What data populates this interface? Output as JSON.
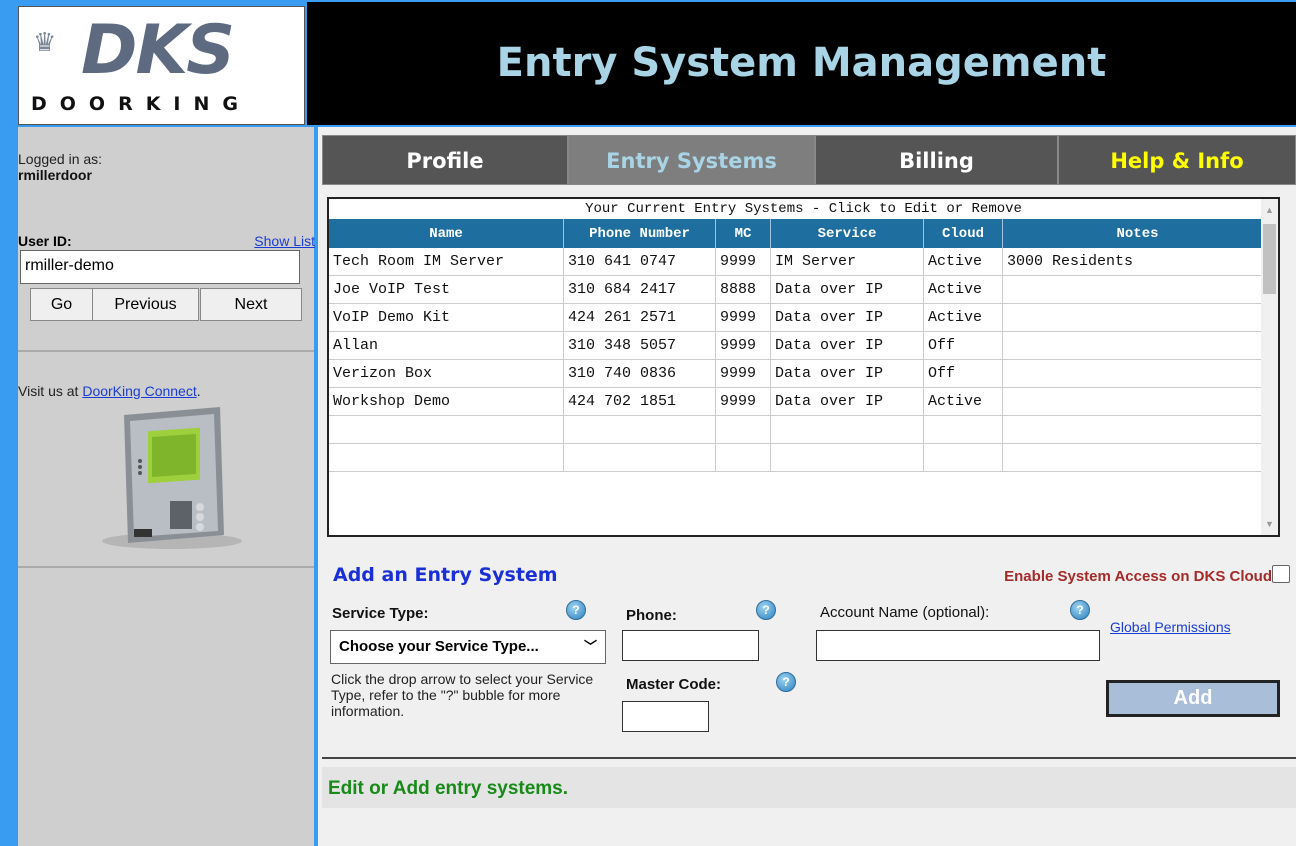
{
  "logo": {
    "brand": "DKS",
    "sub": "DOORKING"
  },
  "header": {
    "title": "Entry System Management"
  },
  "sidebar": {
    "logged_in_label": "Logged in as:",
    "username": "rmillerdoor",
    "user_id_label": "User ID:",
    "show_list": "Show List",
    "user_id_value": "rmiller-demo",
    "go": "Go",
    "previous": "Previous",
    "next": "Next",
    "visit_prefix": "Visit us at ",
    "visit_link": "DoorKing Connect",
    "visit_suffix": "."
  },
  "tabs": [
    {
      "label": "Profile",
      "bg": "#555555",
      "color": "#ffffff"
    },
    {
      "label": "Entry Systems",
      "bg": "#7e7e7e",
      "color": "#a8d4e6"
    },
    {
      "label": "Billing",
      "bg": "#555555",
      "color": "#ffffff"
    },
    {
      "label": "Help & Info",
      "bg": "#555555",
      "color": "#ffff00"
    }
  ],
  "table": {
    "caption": "Your Current Entry Systems - Click to Edit or Remove",
    "headers": [
      "Name",
      "Phone Number",
      "MC",
      "Service",
      "Cloud",
      "Notes"
    ],
    "rows": [
      [
        "Tech Room IM Server",
        "310 641 0747",
        "9999",
        "IM Server",
        "Active",
        "3000 Residents"
      ],
      [
        "Joe VoIP Test",
        "310 684 2417",
        "8888",
        "Data over IP",
        "Active",
        ""
      ],
      [
        "VoIP Demo Kit",
        "424 261 2571",
        "9999",
        "Data over IP",
        "Active",
        ""
      ],
      [
        "Allan",
        "310 348 5057",
        "9999",
        "Data over IP",
        "Off",
        ""
      ],
      [
        "Verizon Box",
        "310 740 0836",
        "9999",
        "Data over IP",
        "Off",
        ""
      ],
      [
        "Workshop Demo",
        "424 702 1851",
        "9999",
        "Data over IP",
        "Active",
        ""
      ],
      [
        "",
        "",
        "",
        "",
        "",
        ""
      ],
      [
        "",
        "",
        "",
        "",
        "",
        ""
      ]
    ]
  },
  "add": {
    "title": "Add an Entry System",
    "cloud_label": "Enable System Access on DKS Cloud",
    "service_type_label": "Service Type:",
    "phone_label": "Phone:",
    "account_label": "Account Name (optional):",
    "global_permissions": "Global Permissions",
    "service_select": "Choose your Service Type...",
    "hint": "Click the drop arrow to select your Service Type, refer to the \"?\" bubble for more information.",
    "master_code_label": "Master Code:",
    "add_button": "Add",
    "help_glyph": "?"
  },
  "status": {
    "message": "Edit or Add entry systems."
  },
  "colors": {
    "accent_blue": "#1a2fd6",
    "table_header": "#1f6ea0",
    "status_green": "#178a17",
    "cloud_red": "#a52a2a"
  }
}
